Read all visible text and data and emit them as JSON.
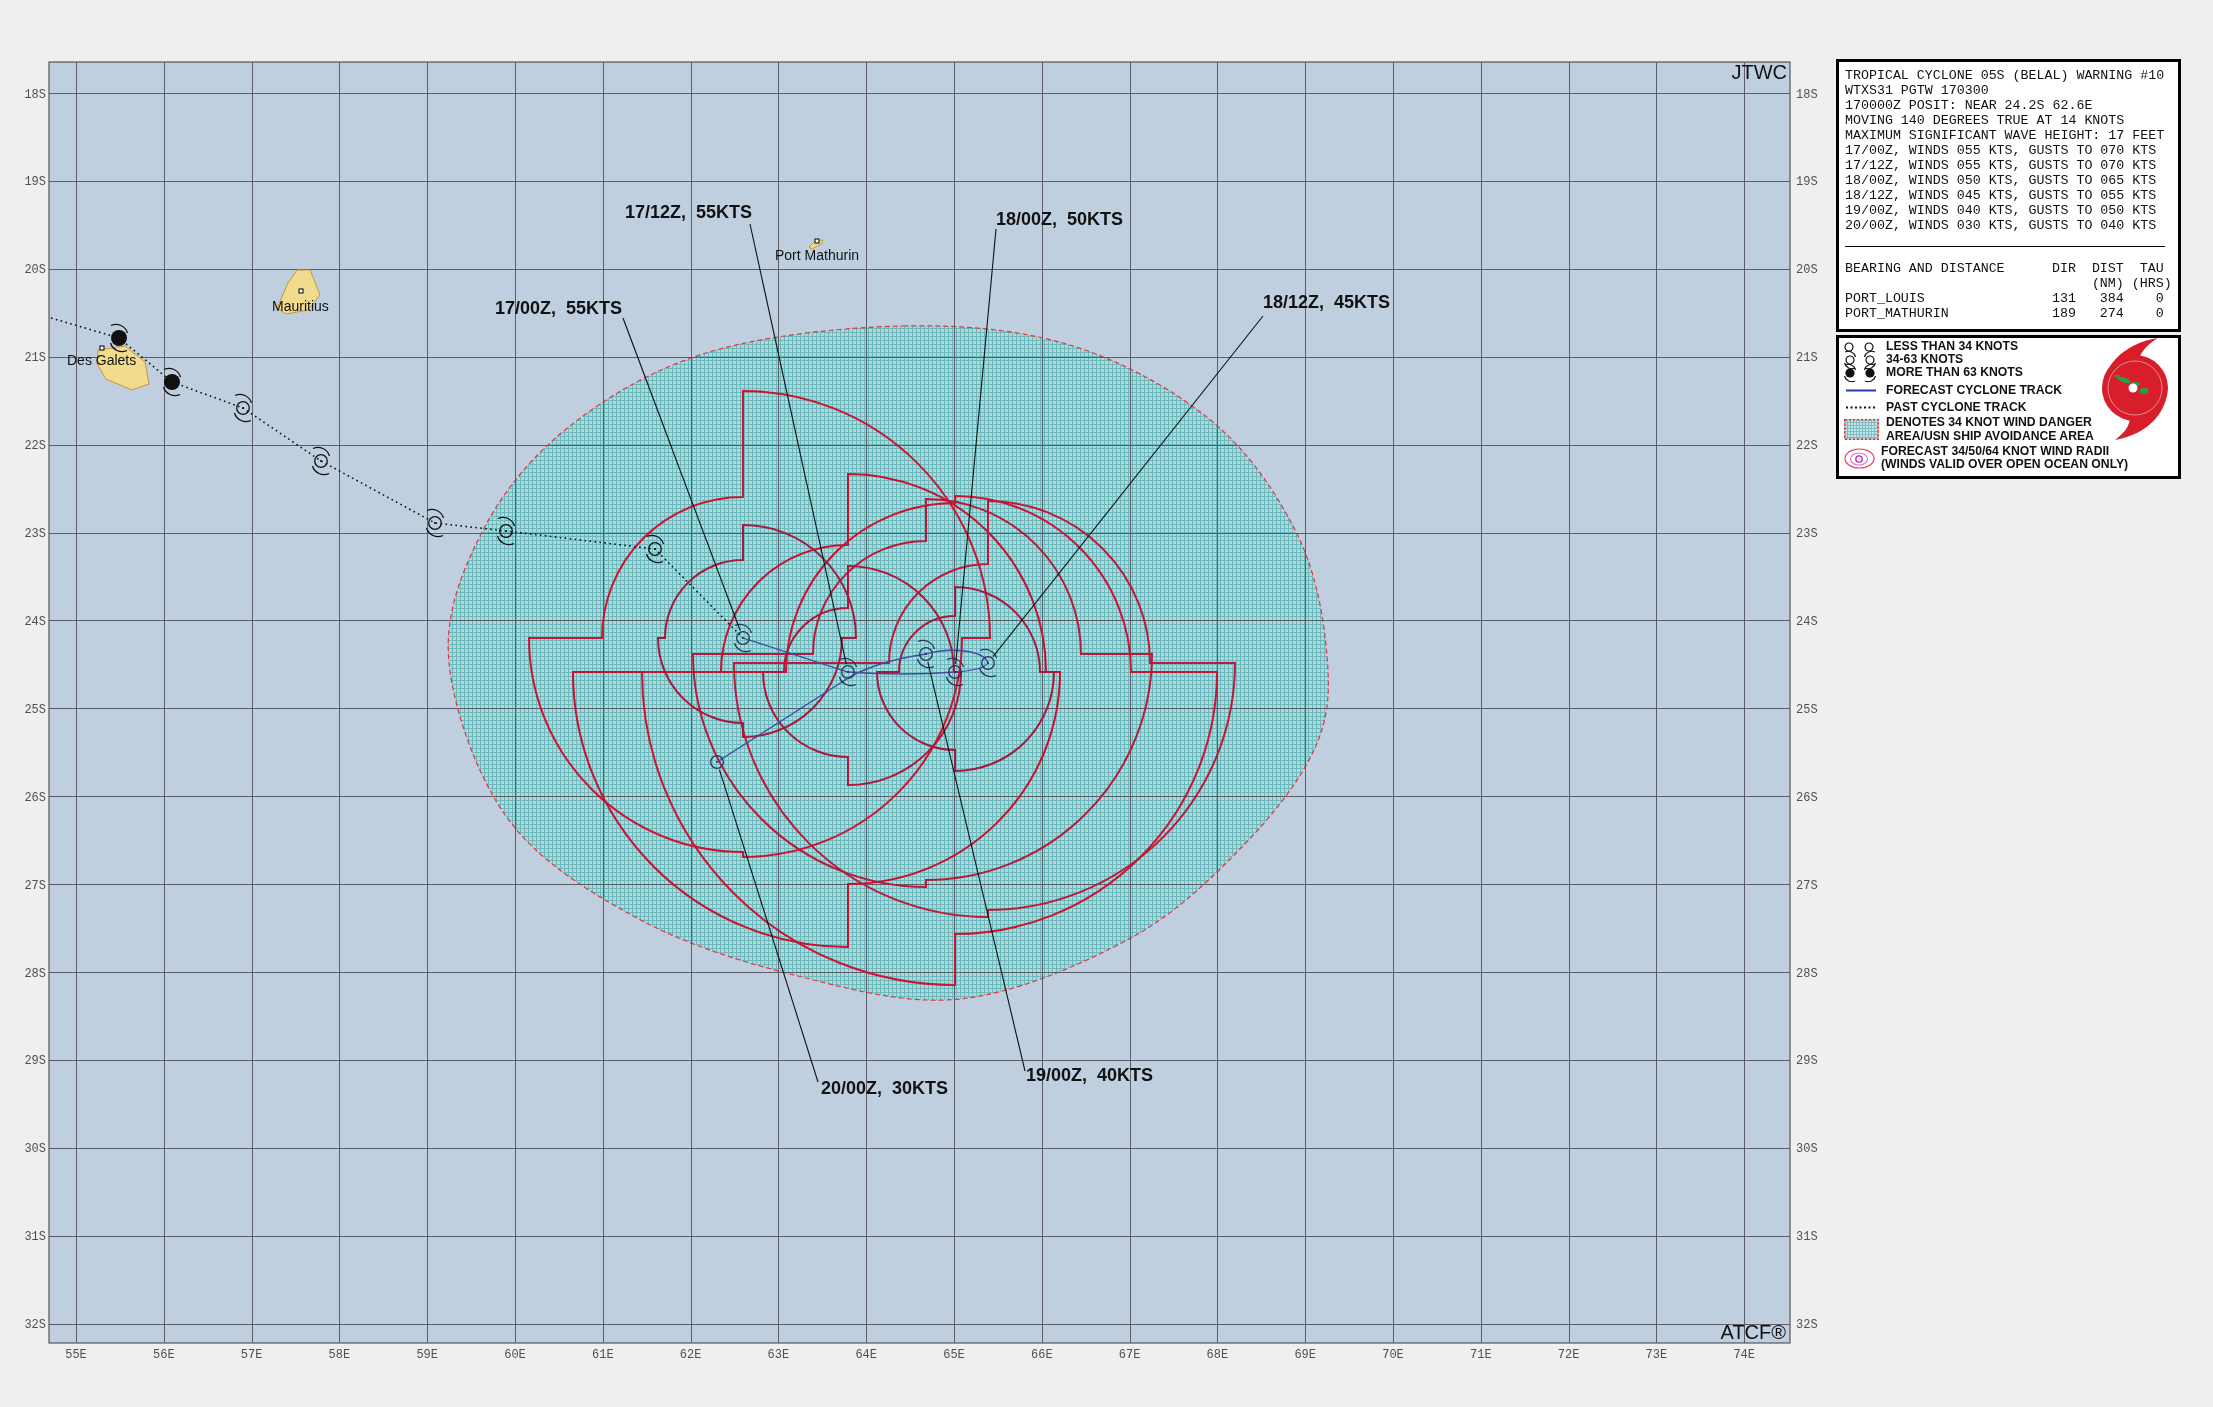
{
  "map": {
    "agency_label": "JTWC",
    "system_label": "ATCF®",
    "latitude_labels_left": [
      "18S",
      "19S",
      "20S",
      "21S",
      "22S",
      "23S",
      "24S",
      "25S",
      "26S",
      "27S",
      "28S",
      "29S",
      "30S",
      "31S",
      "32S"
    ],
    "latitude_labels_right": [
      "18S",
      "19S",
      "20S",
      "21S",
      "22S",
      "23S",
      "24S",
      "25S",
      "26S",
      "27S",
      "28S",
      "29S",
      "30S",
      "31S",
      "32S"
    ],
    "longitude_labels": [
      "55E",
      "56E",
      "57E",
      "58E",
      "59E",
      "60E",
      "61E",
      "62E",
      "63E",
      "64E",
      "65E",
      "66E",
      "67E",
      "68E",
      "69E",
      "70E",
      "71E",
      "72E",
      "73E",
      "74E"
    ],
    "places": [
      {
        "name": "Port Mathurin"
      },
      {
        "name": "Mauritius"
      },
      {
        "name": "Des Galets"
      }
    ],
    "past_positions": [
      {
        "kind": "strong"
      },
      {
        "kind": "strong"
      },
      {
        "kind": "storm"
      },
      {
        "kind": "storm"
      },
      {
        "kind": "storm"
      },
      {
        "kind": "storm"
      },
      {
        "kind": "storm"
      }
    ],
    "forecast_positions": [
      {
        "label": "17/00Z,  55KTS",
        "kind": "storm"
      },
      {
        "label": "17/12Z,  55KTS",
        "kind": "storm"
      },
      {
        "label": "18/00Z,  50KTS",
        "kind": "storm"
      },
      {
        "label": "18/12Z,  45KTS",
        "kind": "storm"
      },
      {
        "label": "19/00Z,  40KTS",
        "kind": "storm"
      },
      {
        "label": "20/00Z,  30KTS",
        "kind": "weak"
      }
    ]
  },
  "warning": {
    "lines": [
      "TROPICAL CYCLONE 05S (BELAL) WARNING #10",
      "WTXS31 PGTW 170300",
      "170000Z POSIT: NEAR 24.2S 62.6E",
      "MOVING 140 DEGREES TRUE AT 14 KNOTS",
      "MAXIMUM SIGNIFICANT WAVE HEIGHT: 17 FEET",
      "17/00Z, WINDS 055 KTS, GUSTS TO 070 KTS",
      "17/12Z, WINDS 055 KTS, GUSTS TO 070 KTS",
      "18/00Z, WINDS 050 KTS, GUSTS TO 065 KTS",
      "18/12Z, WINDS 045 KTS, GUSTS TO 055 KTS",
      "19/00Z, WINDS 040 KTS, GUSTS TO 050 KTS",
      "20/00Z, WINDS 030 KTS, GUSTS TO 040 KTS"
    ],
    "bearing_table": {
      "title": "BEARING AND DISTANCE",
      "columns": [
        {
          "label": "DIR"
        },
        {
          "label": "DIST",
          "unit": "(NM)"
        },
        {
          "label": "TAU",
          "unit": "(HRS)"
        }
      ],
      "rows": [
        {
          "name": "PORT_LOUIS",
          "dir": "131",
          "dist": "384",
          "tau": "0"
        },
        {
          "name": "PORT_MATHURIN",
          "dir": "189",
          "dist": "274",
          "tau": "0"
        }
      ]
    }
  },
  "legend": {
    "items": [
      {
        "kind": "weak",
        "text": "LESS THAN 34 KNOTS"
      },
      {
        "kind": "storm",
        "text": "34-63 KNOTS"
      },
      {
        "kind": "strong",
        "text": "MORE THAN 63 KNOTS"
      },
      {
        "kind": "forecast_track",
        "text": "FORECAST CYCLONE TRACK"
      },
      {
        "kind": "past_track",
        "text": "PAST CYCLONE TRACK"
      },
      {
        "kind": "danger_area",
        "lines": [
          "DENOTES 34 KNOT WIND DANGER",
          "AREA/USN SHIP AVOIDANCE AREA"
        ]
      },
      {
        "kind": "wind_radii",
        "lines": [
          "FORECAST 34/50/64 KNOT WIND RADII",
          "(WINDS VALID OVER OPEN OCEAN ONLY)"
        ]
      }
    ]
  }
}
